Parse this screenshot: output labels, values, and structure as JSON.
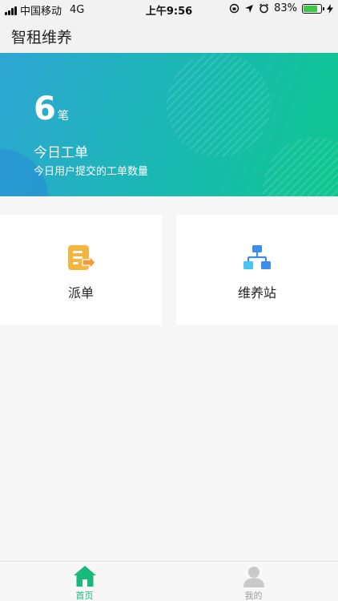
{
  "status_bar": {
    "carrier": "中国移动",
    "network": "4G",
    "time": "上午9:56",
    "battery": "83%",
    "battery_level": 0.83
  },
  "nav": {
    "title": "智租维养"
  },
  "banner": {
    "count": "6",
    "count_unit": "笔",
    "title": "今日工单",
    "subtitle": "今日用户提交的工单数量"
  },
  "cards": [
    {
      "label": "派单",
      "icon": "dispatch-order-icon"
    },
    {
      "label": "维养站",
      "icon": "station-hierarchy-icon"
    }
  ],
  "tabbar": {
    "items": [
      {
        "label": "首页",
        "icon": "home-icon",
        "active": true
      },
      {
        "label": "我的",
        "icon": "user-icon",
        "active": false
      }
    ]
  },
  "colors": {
    "accent": "#18b97a",
    "banner_start": "#2fa6d5",
    "banner_end": "#0fc78e",
    "dispatch_icon": "#f4b63f",
    "station_icon": "#3d8ee8"
  }
}
